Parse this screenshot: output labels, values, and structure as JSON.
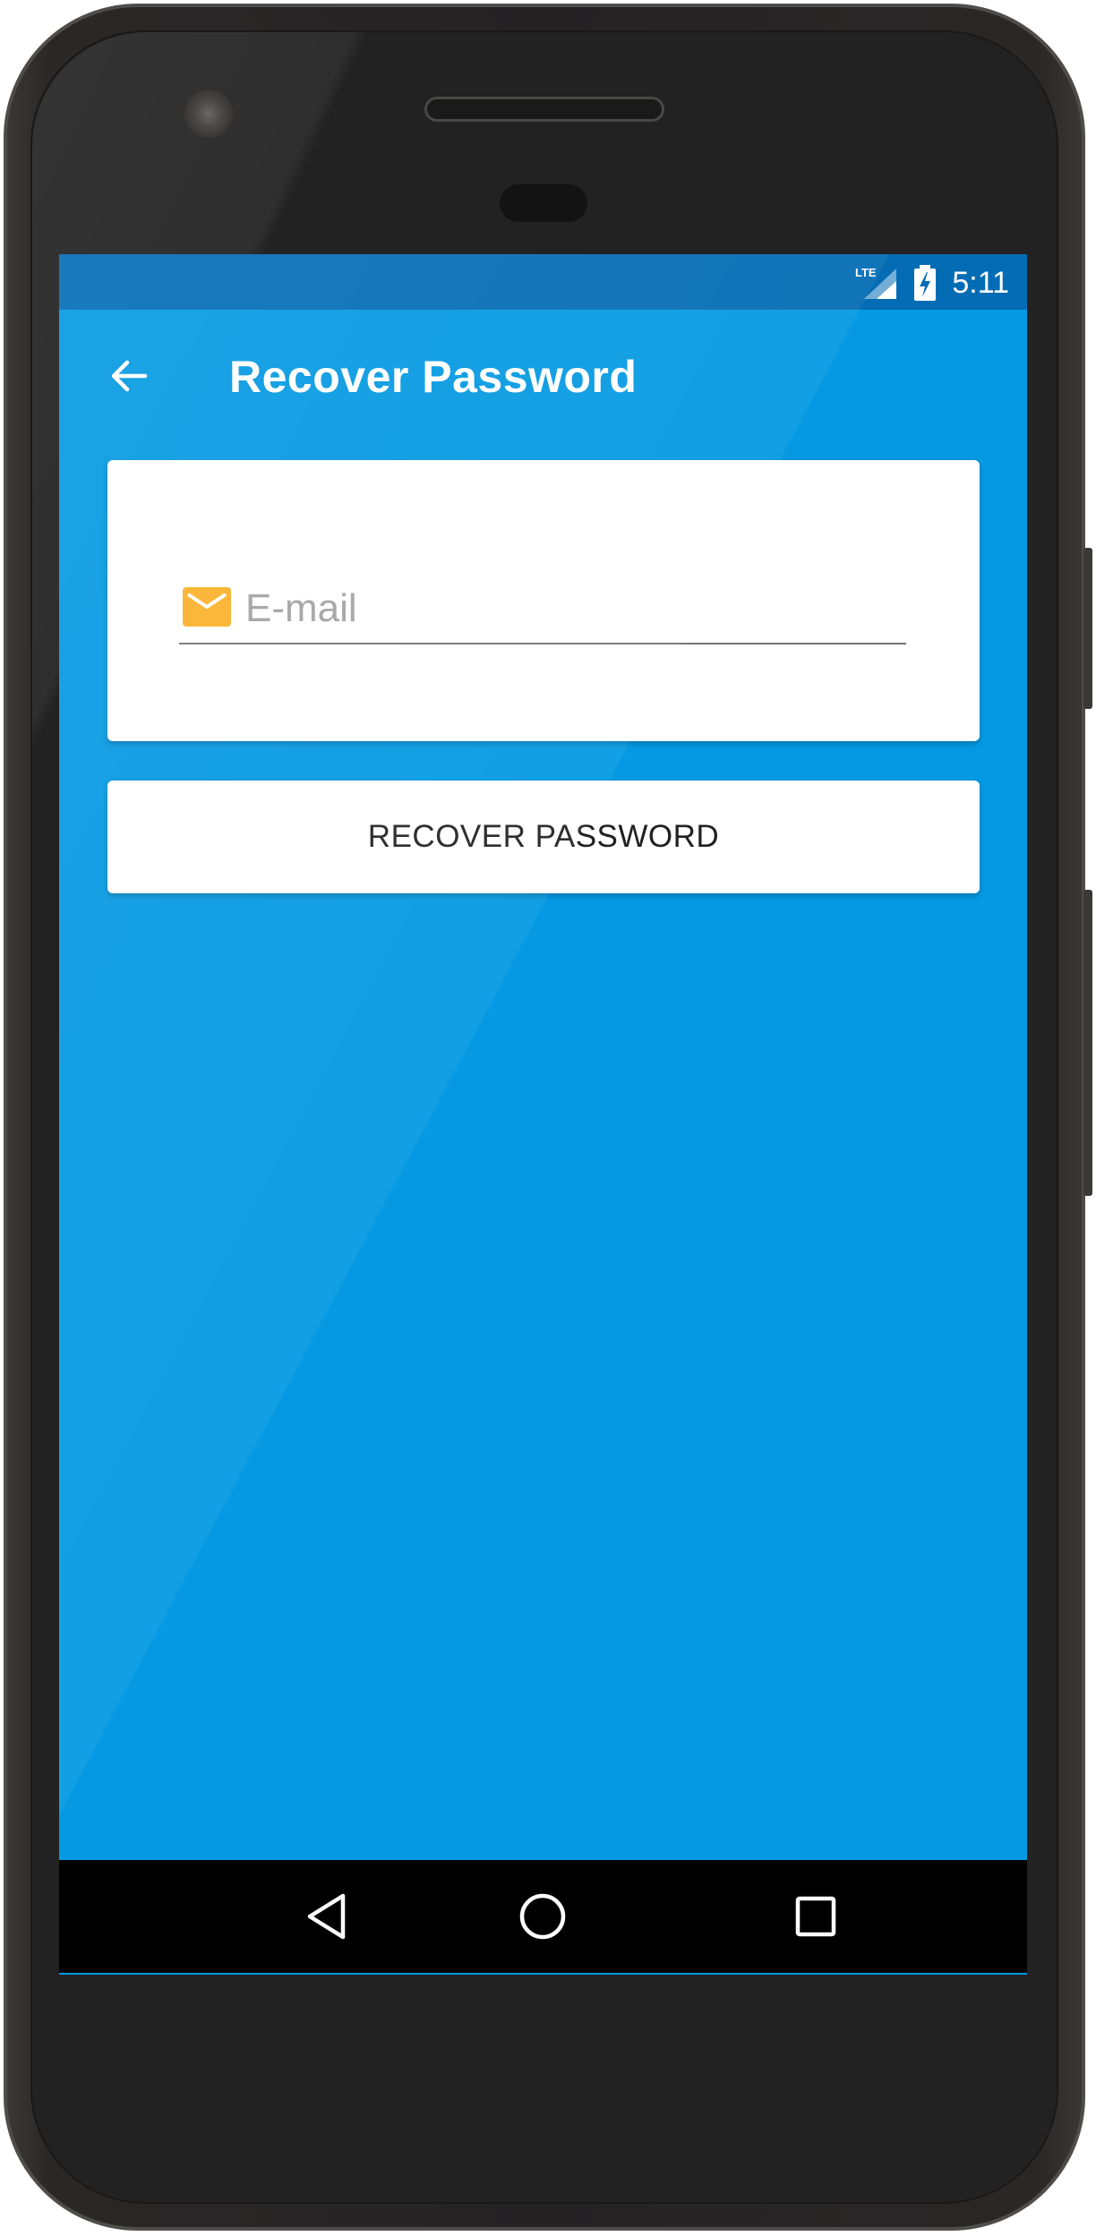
{
  "status_bar": {
    "network_label": "LTE",
    "time": "5:11",
    "icons": [
      "lte-signal-icon",
      "battery-charging-icon"
    ]
  },
  "app_bar": {
    "back_icon": "arrow-left-icon",
    "title": "Recover Password"
  },
  "form": {
    "email_icon": "mail-icon",
    "email_placeholder": "E-mail",
    "email_value": ""
  },
  "actions": {
    "recover_label": "RECOVER PASSWORD"
  },
  "nav_bar": {
    "buttons": [
      "back-triangle-icon",
      "home-circle-icon",
      "recents-square-icon"
    ]
  },
  "colors": {
    "primary": "#0499e2",
    "status_bar": "#036cb4",
    "mail_icon": "#fbb12a",
    "surface": "#ffffff"
  }
}
